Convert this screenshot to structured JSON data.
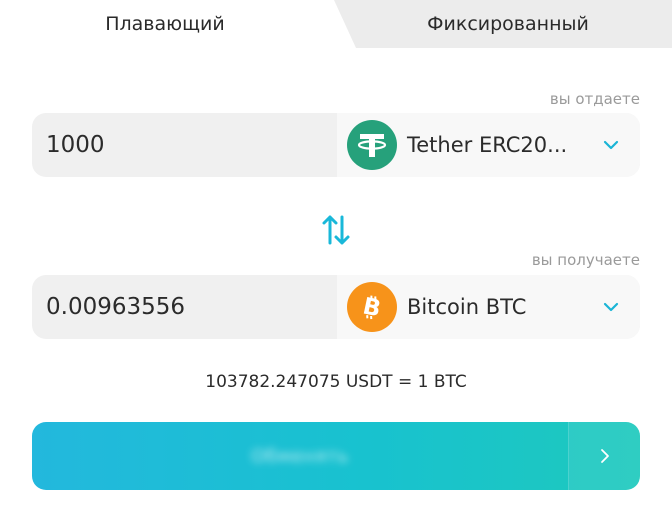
{
  "tabs": [
    {
      "label": "Плавающий",
      "active": true
    },
    {
      "label": "Фиксированный",
      "active": false
    }
  ],
  "send": {
    "hint": "вы отдаете",
    "amount": "1000",
    "currency": "Tether ERC20...",
    "coin_icon": "tether-icon"
  },
  "receive": {
    "hint": "вы получаете",
    "amount": "0.00963556",
    "currency": "Bitcoin BTC",
    "coin_icon": "bitcoin-icon"
  },
  "rate": "103782.247075 USDT = 1 BTC",
  "exchange_button": {
    "label": "Обменять",
    "arrow_icon": "chevron-right-icon"
  },
  "colors": {
    "accent": "#1fc0d3",
    "tether": "#26a17b",
    "bitcoin": "#f7931a",
    "field_bg": "#f0f0f0",
    "inactive_tab": "#ececec"
  }
}
